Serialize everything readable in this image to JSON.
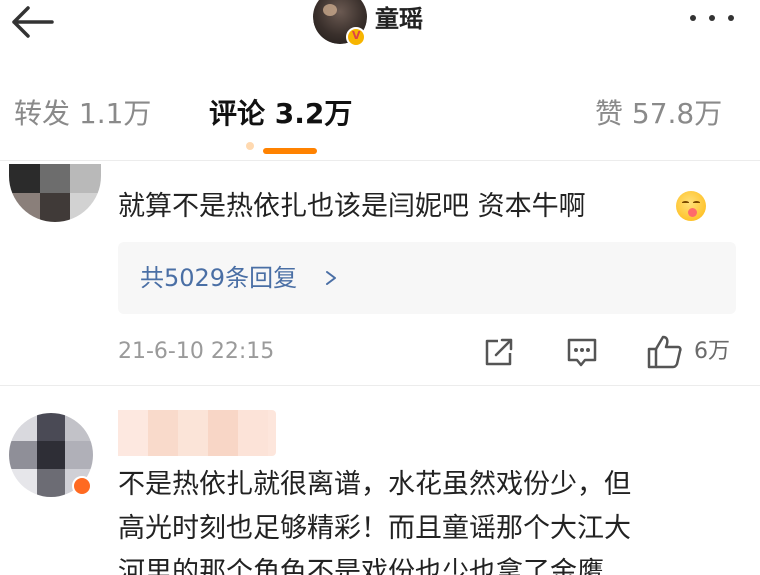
{
  "header": {
    "back_icon": "back-arrow-icon",
    "username": "童瑶",
    "verified_badge": "V",
    "more_icon": "more-dots-icon"
  },
  "tabs": [
    {
      "label": "转发 1.1万",
      "active": false
    },
    {
      "label": "评论 3.2万",
      "active": true
    },
    {
      "label": "赞 57.8万",
      "active": false
    }
  ],
  "accent_color": "#ff8200",
  "link_color": "#4a6fa5",
  "comments": [
    {
      "text": "就算不是热依扎也该是闫妮吧 资本牛啊",
      "emoji": "yum-face-emoji",
      "replies_label": "共5029条回复",
      "time": "21-6-10 22:15",
      "likes": "6万"
    },
    {
      "text_lines": [
        "不是热依扎就很离谱，水花虽然戏份少，但",
        "高光时刻也足够精彩！而且童谣那个大江大",
        "河里的那个角色不是戏份也少也拿了金鹰"
      ]
    }
  ]
}
